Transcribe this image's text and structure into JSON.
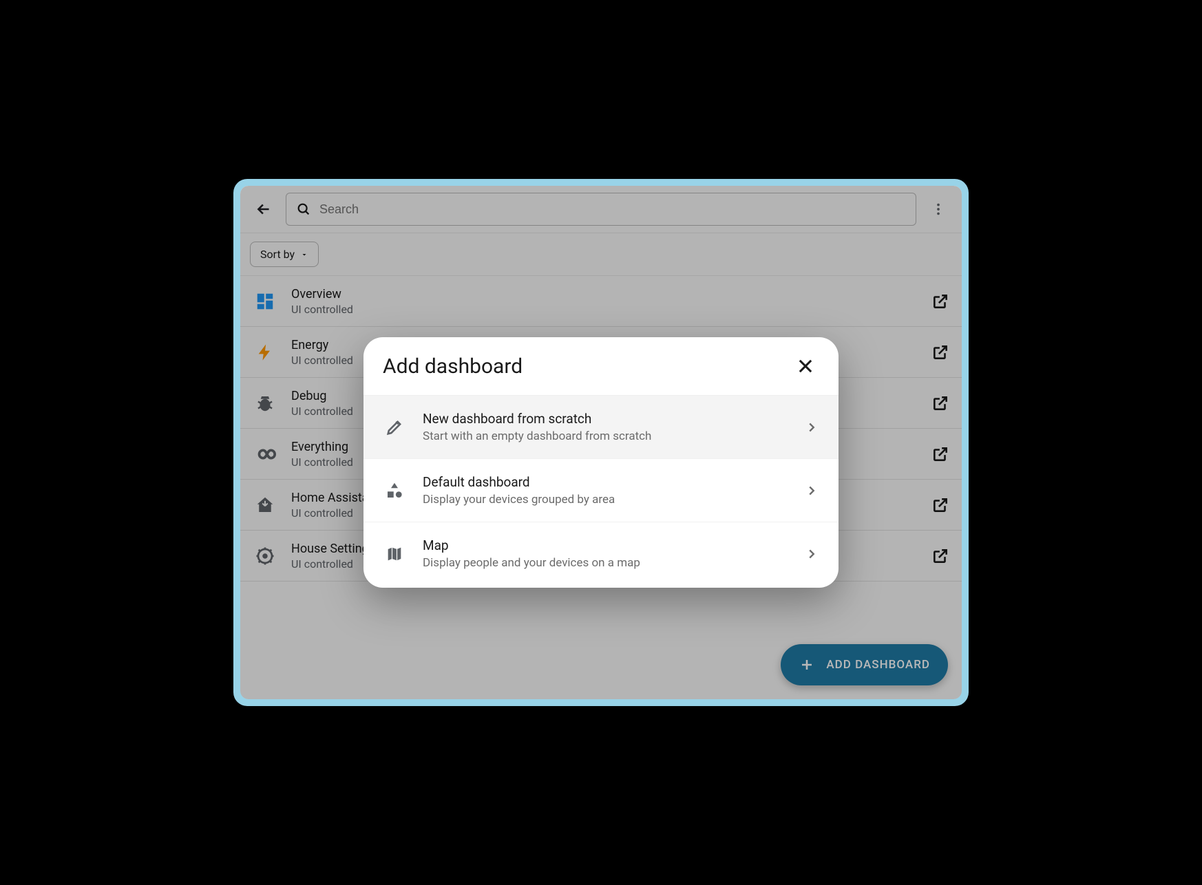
{
  "header": {
    "search_placeholder": "Search"
  },
  "filter": {
    "sort_label": "Sort by"
  },
  "dashboards": [
    {
      "icon": "dashboard",
      "title": "Overview",
      "subtitle": "UI controlled"
    },
    {
      "icon": "energy",
      "title": "Energy",
      "subtitle": "UI controlled"
    },
    {
      "icon": "bug",
      "title": "Debug",
      "subtitle": "UI controlled"
    },
    {
      "icon": "infinity",
      "title": "Everything",
      "subtitle": "UI controlled"
    },
    {
      "icon": "home",
      "title": "Home Assistant",
      "subtitle": "UI controlled"
    },
    {
      "icon": "gear-head",
      "title": "House Settings",
      "subtitle": "UI controlled"
    }
  ],
  "fab": {
    "label": "ADD DASHBOARD"
  },
  "dialog": {
    "title": "Add dashboard",
    "options": [
      {
        "icon": "pencil",
        "title": "New dashboard from scratch",
        "subtitle": "Start with an empty dashboard from scratch"
      },
      {
        "icon": "shapes",
        "title": "Default dashboard",
        "subtitle": "Display your devices grouped by area"
      },
      {
        "icon": "map",
        "title": "Map",
        "subtitle": "Display people and your devices on a map"
      }
    ]
  },
  "colors": {
    "accent": "#1f7aa6",
    "frame": "#98d3e8",
    "icon_blue": "#2196f3",
    "icon_amber": "#ff9800"
  }
}
